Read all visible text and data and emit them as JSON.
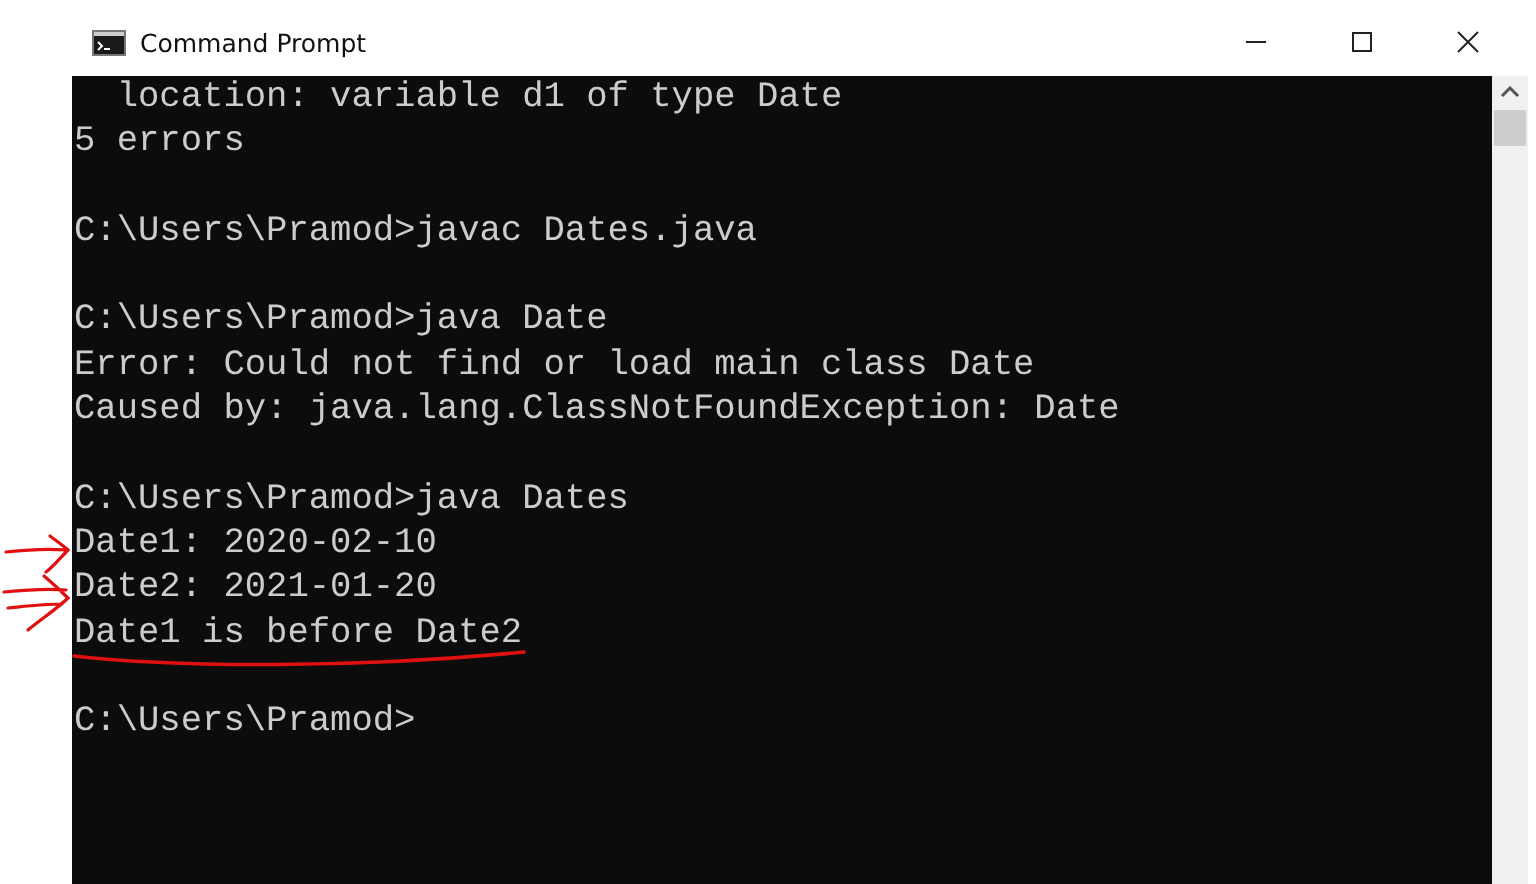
{
  "window": {
    "title": "Command Prompt"
  },
  "console": {
    "blocks": [
      [
        "  location: variable d1 of type Date",
        "5 errors"
      ],
      [
        "C:\\Users\\Pramod>javac Dates.java"
      ],
      [
        "C:\\Users\\Pramod>java Date",
        "Error: Could not find or load main class Date",
        "Caused by: java.lang.ClassNotFoundException: Date"
      ],
      [
        "C:\\Users\\Pramod>java Dates",
        "Date1: 2020-02-10",
        "Date2: 2021-01-20",
        "Date1 is before Date2"
      ],
      [
        "C:\\Users\\Pramod>"
      ]
    ]
  }
}
